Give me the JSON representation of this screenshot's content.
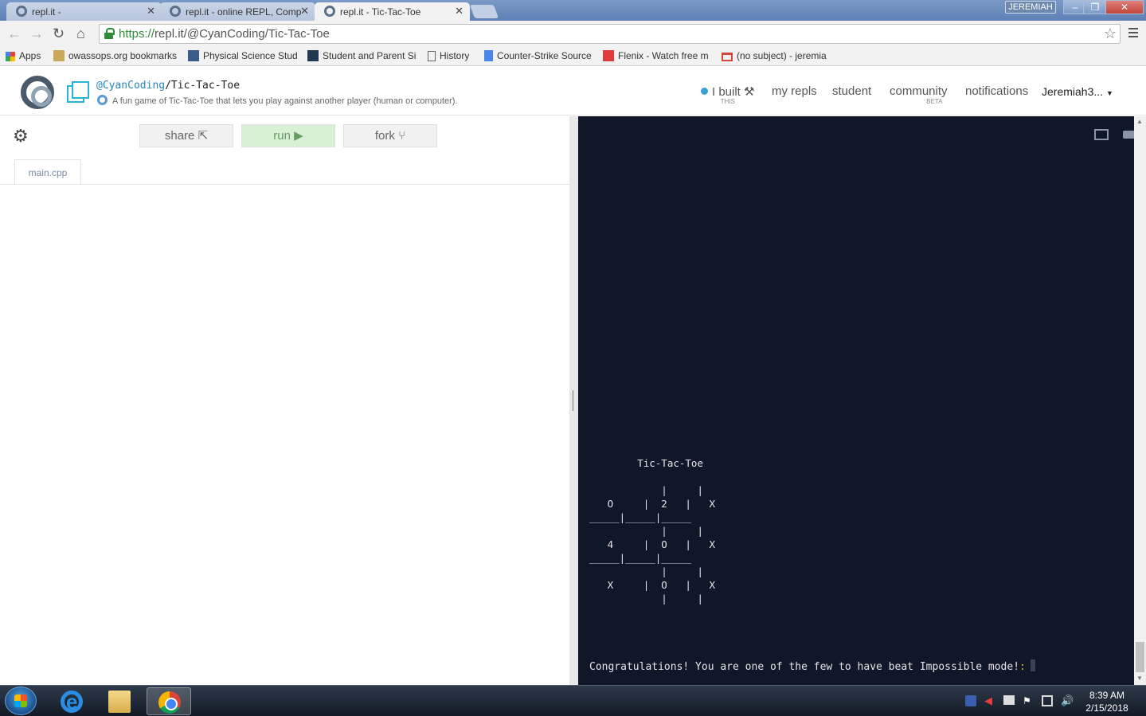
{
  "browser": {
    "tabs": [
      {
        "title": "repl.it -"
      },
      {
        "title": "repl.it - online REPL, Comp"
      },
      {
        "title": "repl.it - Tic-Tac-Toe"
      }
    ],
    "user_badge": "JEREMIAH",
    "url_scheme": "https://",
    "url_rest": "repl.it/@CyanCoding/Tic-Tac-Toe",
    "bookmarks": [
      {
        "label": "Apps"
      },
      {
        "label": "owassops.org bookmarks"
      },
      {
        "label": "Physical Science Stud"
      },
      {
        "label": "Student and Parent Si"
      },
      {
        "label": "History"
      },
      {
        "label": "Counter-Strike Source"
      },
      {
        "label": "Flenix - Watch free m"
      },
      {
        "label": "(no subject) - jeremia"
      }
    ]
  },
  "repl": {
    "owner": "@CyanCoding",
    "separator": "/",
    "name": "Tic-Tac-Toe",
    "description": "A fun game of Tic-Tac-Toe that lets you play against another player (human or computer).",
    "nav": {
      "ibuilt": "I built",
      "ibuilt_sub": "THIS",
      "my_repls": "my repls",
      "student": "student",
      "community": "community",
      "community_sub": "BETA",
      "notifications": "notifications",
      "user": "Jeremiah3..."
    }
  },
  "editor": {
    "share_label": "share",
    "run_label": "run",
    "fork_label": "fork",
    "file_tab": "main.cpp"
  },
  "console": {
    "output": "        Tic-Tac-Toe\n\n            |     |\n   O     |  2   |   X\n_____|_____|_____\n            |     |\n   4     |  O   |   X\n_____|_____|_____\n            |     |\n   X     |  O   |   X\n            |     |",
    "final_message": "Congratulations! You are one of the few to have beat Impossible mode!",
    "prompt_symbol": ":"
  },
  "taskbar": {
    "time": "8:39 AM",
    "date": "2/15/2018"
  },
  "colors": {
    "console_bg": "#101729",
    "accent": "#2ab4d3",
    "run_bg": "#d9f0d6"
  }
}
